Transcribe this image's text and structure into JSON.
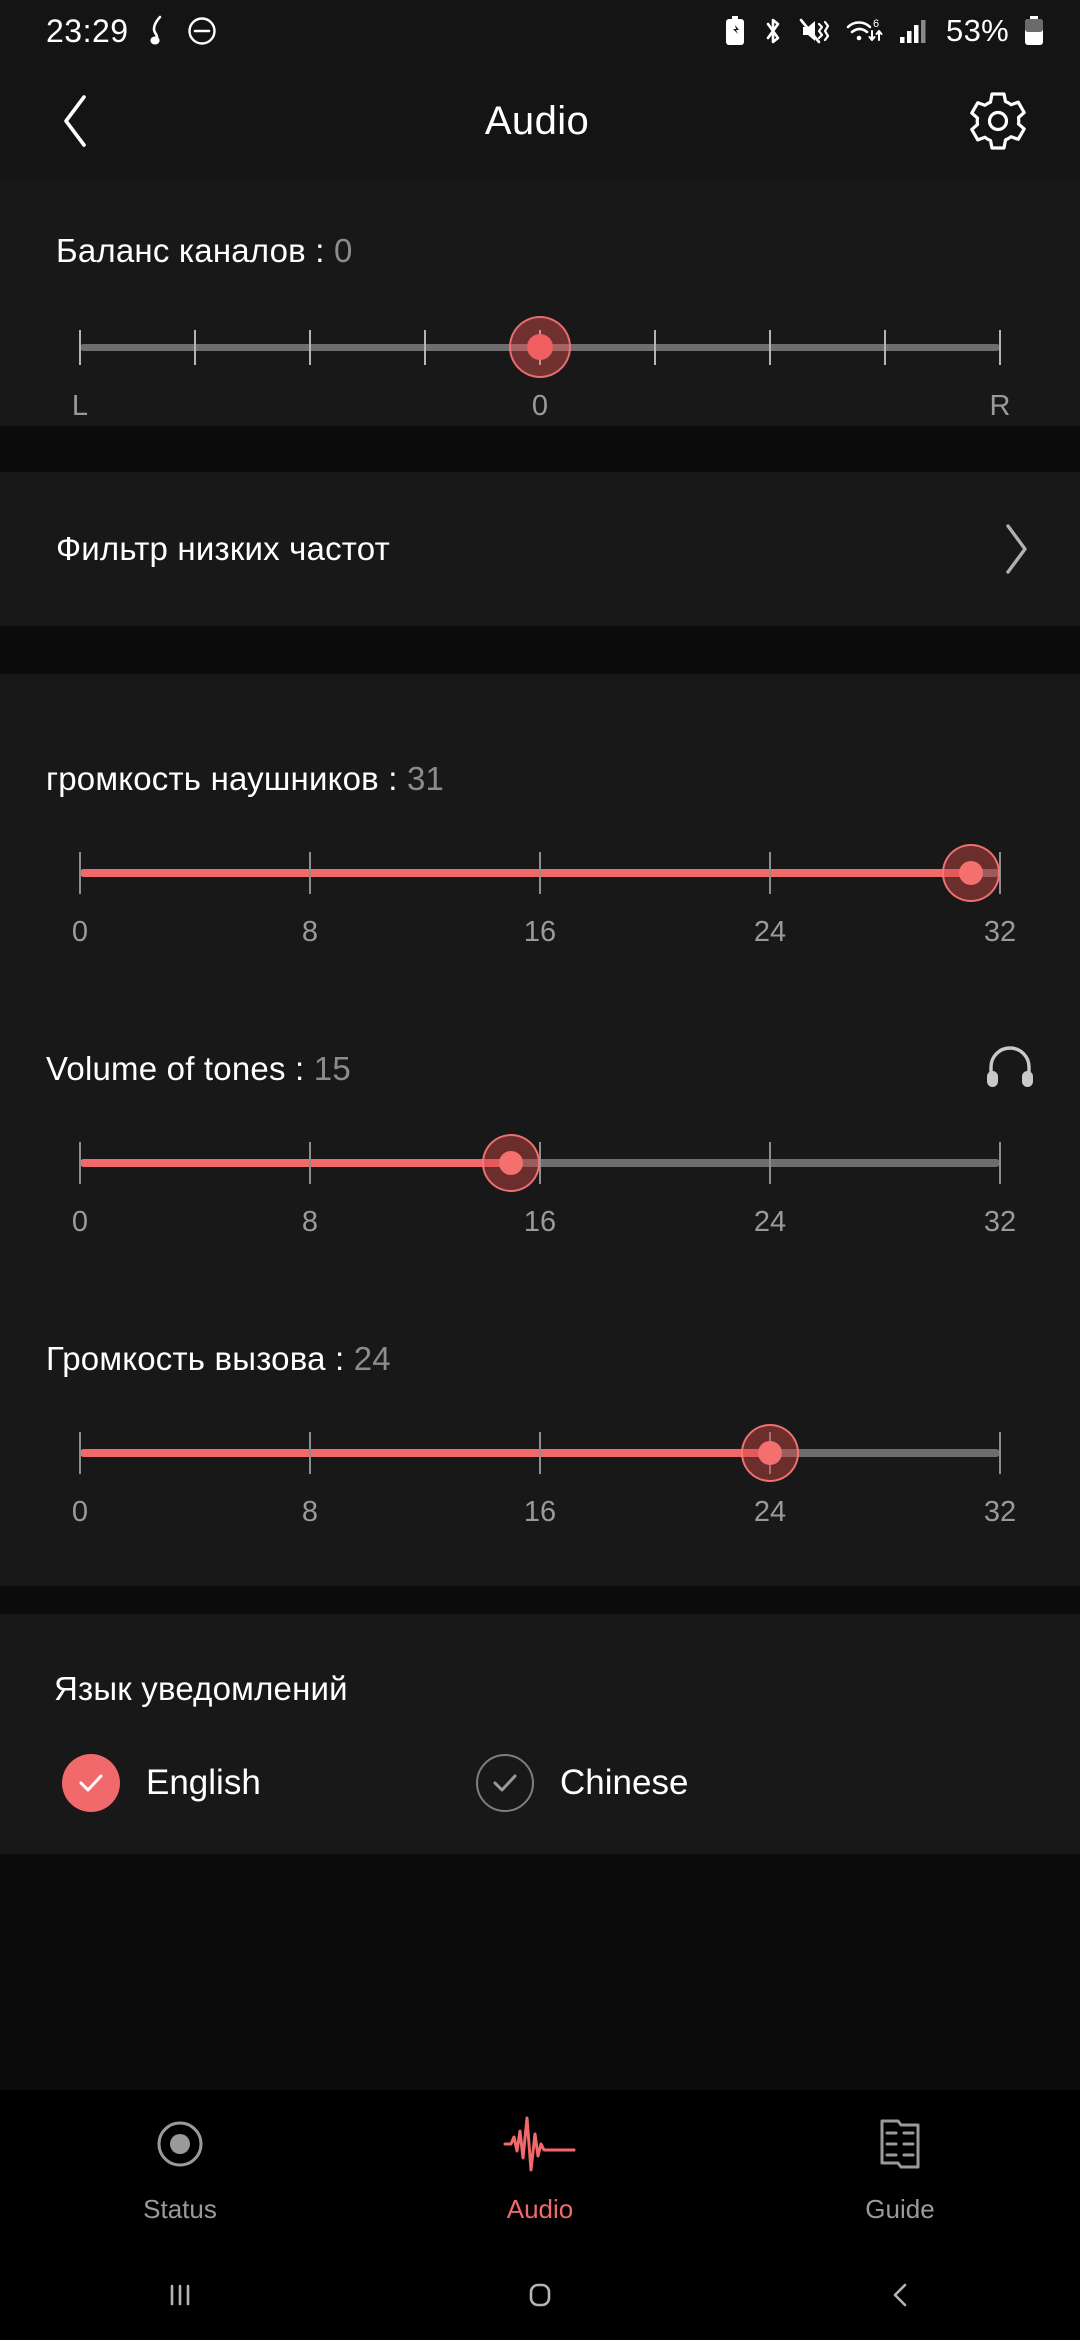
{
  "status_bar": {
    "time": "23:29",
    "battery_percent": "53%",
    "icons": [
      "music-note-icon",
      "do-not-disturb-icon",
      "battery-saver-icon",
      "bluetooth-icon",
      "mute-vibrate-icon",
      "wifi-6-icon",
      "cellular-signal-icon",
      "battery-icon"
    ]
  },
  "header": {
    "title": "Audio",
    "back_icon": "chevron-left-icon",
    "settings_icon": "gear-icon"
  },
  "balance": {
    "label": "Баланс каналов :",
    "value": "0",
    "axis_labels": [
      "L",
      "0",
      "R"
    ],
    "thumb_percent": 50,
    "tick_count": 9
  },
  "low_pass_filter": {
    "label": "Фильтр низких частот",
    "chevron_icon": "chevron-right-icon"
  },
  "sliders": [
    {
      "name": "headphone-volume",
      "label": "громкость наушников :",
      "value": "31",
      "fill_percent": 96.9,
      "min": 0,
      "max": 32,
      "ticks": [
        "0",
        "8",
        "16",
        "24",
        "32"
      ],
      "has_headphone_icon": false
    },
    {
      "name": "volume-of-tones",
      "label": "Volume of tones :",
      "value": "15",
      "fill_percent": 46.9,
      "min": 0,
      "max": 32,
      "ticks": [
        "0",
        "8",
        "16",
        "24",
        "32"
      ],
      "has_headphone_icon": true,
      "headphone_icon": "headphones-icon"
    },
    {
      "name": "call-volume",
      "label": "Громкость вызова :",
      "value": "24",
      "fill_percent": 75,
      "min": 0,
      "max": 32,
      "ticks": [
        "0",
        "8",
        "16",
        "24",
        "32"
      ],
      "has_headphone_icon": false
    }
  ],
  "language": {
    "title": "Язык уведомлений",
    "options": [
      {
        "label": "English",
        "selected": true
      },
      {
        "label": "Chinese",
        "selected": false
      }
    ]
  },
  "tabs": [
    {
      "label": "Status",
      "icon": "record-circle-icon",
      "active": false
    },
    {
      "label": "Audio",
      "icon": "waveform-icon",
      "active": true
    },
    {
      "label": "Guide",
      "icon": "guide-card-icon",
      "active": false
    }
  ],
  "android_nav": {
    "recents_icon": "recents-icon",
    "home_icon": "home-icon",
    "back_icon": "back-icon"
  },
  "colors": {
    "accent": "#f2696b",
    "card_bg": "#181818",
    "gap_bg": "#0b0b0b",
    "text": "#ffffff",
    "muted": "#8c8c8c"
  }
}
